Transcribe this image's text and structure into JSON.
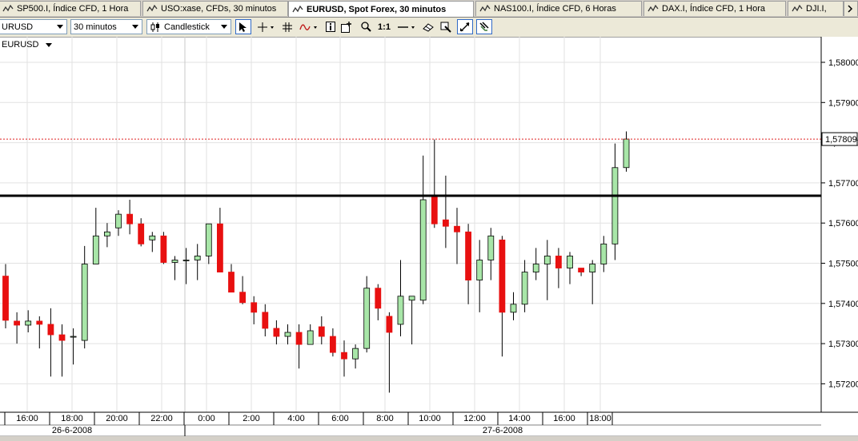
{
  "tabs": [
    {
      "label": "SP500.I, Índice CFD, 1 Hora",
      "active": false
    },
    {
      "label": "USO:xase, CFDs, 30 minutos",
      "active": false
    },
    {
      "label": "EURUSD, Spot Forex, 30 minutos",
      "active": true
    },
    {
      "label": "NAS100.I, Índice CFD, 6 Horas",
      "active": false
    },
    {
      "label": "DAX.I, Índice CFD, 1 Hora",
      "active": false
    },
    {
      "label": "DJI.I,",
      "active": false
    }
  ],
  "toolbar": {
    "symbol_value": "URUSD",
    "timeframe_value": "30 minutos",
    "charttype_value": "Candlestick",
    "ratio_label": "1:1"
  },
  "chart_title": "EURUSD",
  "colors": {
    "up": "#a8e6a8",
    "down": "#e81010",
    "horizontal_line": "#000000",
    "price_line": "#e02020"
  },
  "chart_data": {
    "type": "candlestick",
    "symbol": "EURUSD",
    "y_ticks": [
      "1,58000",
      "1,57900",
      "1,57800",
      "1,57700",
      "1,57600",
      "1,57500",
      "1,57400",
      "1,57300",
      "1,57200"
    ],
    "y_tick_values": [
      1.58,
      1.579,
      1.578,
      1.577,
      1.576,
      1.575,
      1.574,
      1.573,
      1.572
    ],
    "ylim": [
      1.5714,
      1.5814
    ],
    "current_price": "1,57809",
    "current_price_value": 1.57809,
    "horizontal_line_value": 1.57668,
    "x_ticks": [
      "16:00",
      "18:00",
      "20:00",
      "22:00",
      "0:00",
      "2:00",
      "4:00",
      "6:00",
      "8:00",
      "10:00",
      "12:00",
      "14:00",
      "16:00",
      "18:00"
    ],
    "dates": [
      "26-6-2008",
      "27-6-2008"
    ],
    "candles": [
      {
        "o": 1.57468,
        "h": 1.57498,
        "l": 1.57338,
        "c": 1.57358
      },
      {
        "o": 1.57356,
        "h": 1.57378,
        "l": 1.573,
        "c": 1.57346
      },
      {
        "o": 1.57346,
        "h": 1.57383,
        "l": 1.57328,
        "c": 1.57356
      },
      {
        "o": 1.57356,
        "h": 1.57368,
        "l": 1.57288,
        "c": 1.57348
      },
      {
        "o": 1.57348,
        "h": 1.57388,
        "l": 1.57218,
        "c": 1.57322
      },
      {
        "o": 1.57322,
        "h": 1.57348,
        "l": 1.57218,
        "c": 1.57308
      },
      {
        "o": 1.57318,
        "h": 1.57338,
        "l": 1.57248,
        "c": 1.57318
      },
      {
        "o": 1.57308,
        "h": 1.57543,
        "l": 1.57288,
        "c": 1.57498
      },
      {
        "o": 1.57498,
        "h": 1.57638,
        "l": 1.57498,
        "c": 1.57568
      },
      {
        "o": 1.57568,
        "h": 1.576,
        "l": 1.5754,
        "c": 1.57578
      },
      {
        "o": 1.57588,
        "h": 1.57632,
        "l": 1.57568,
        "c": 1.57622
      },
      {
        "o": 1.57622,
        "h": 1.57658,
        "l": 1.57572,
        "c": 1.57598
      },
      {
        "o": 1.57598,
        "h": 1.57612,
        "l": 1.57542,
        "c": 1.57548
      },
      {
        "o": 1.57558,
        "h": 1.57578,
        "l": 1.57528,
        "c": 1.57568
      },
      {
        "o": 1.57568,
        "h": 1.57578,
        "l": 1.57498,
        "c": 1.57502
      },
      {
        "o": 1.57502,
        "h": 1.57518,
        "l": 1.57458,
        "c": 1.57508
      },
      {
        "o": 1.57508,
        "h": 1.57538,
        "l": 1.57448,
        "c": 1.57508
      },
      {
        "o": 1.57508,
        "h": 1.57548,
        "l": 1.57458,
        "c": 1.57518
      },
      {
        "o": 1.57518,
        "h": 1.57598,
        "l": 1.57498,
        "c": 1.57598
      },
      {
        "o": 1.57598,
        "h": 1.57638,
        "l": 1.57478,
        "c": 1.57478
      },
      {
        "o": 1.57478,
        "h": 1.57498,
        "l": 1.57428,
        "c": 1.57428
      },
      {
        "o": 1.57428,
        "h": 1.57468,
        "l": 1.57398,
        "c": 1.57402
      },
      {
        "o": 1.57402,
        "h": 1.57418,
        "l": 1.57348,
        "c": 1.57378
      },
      {
        "o": 1.57378,
        "h": 1.57398,
        "l": 1.57318,
        "c": 1.57338
      },
      {
        "o": 1.57338,
        "h": 1.57358,
        "l": 1.57298,
        "c": 1.57318
      },
      {
        "o": 1.57318,
        "h": 1.57348,
        "l": 1.57298,
        "c": 1.57328
      },
      {
        "o": 1.57328,
        "h": 1.57348,
        "l": 1.57238,
        "c": 1.57298
      },
      {
        "o": 1.57298,
        "h": 1.57348,
        "l": 1.57298,
        "c": 1.57332
      },
      {
        "o": 1.57342,
        "h": 1.57368,
        "l": 1.57298,
        "c": 1.57318
      },
      {
        "o": 1.57318,
        "h": 1.57338,
        "l": 1.57268,
        "c": 1.57278
      },
      {
        "o": 1.57278,
        "h": 1.57308,
        "l": 1.57218,
        "c": 1.57262
      },
      {
        "o": 1.57262,
        "h": 1.57298,
        "l": 1.57238,
        "c": 1.57288
      },
      {
        "o": 1.57288,
        "h": 1.57468,
        "l": 1.57278,
        "c": 1.57438
      },
      {
        "o": 1.57438,
        "h": 1.57448,
        "l": 1.57358,
        "c": 1.57388
      },
      {
        "o": 1.57368,
        "h": 1.57378,
        "l": 1.57178,
        "c": 1.57328
      },
      {
        "o": 1.57348,
        "h": 1.57508,
        "l": 1.57318,
        "c": 1.57418
      },
      {
        "o": 1.57408,
        "h": 1.57418,
        "l": 1.57298,
        "c": 1.57418
      },
      {
        "o": 1.57408,
        "h": 1.57768,
        "l": 1.57398,
        "c": 1.57658
      },
      {
        "o": 1.57668,
        "h": 1.57808,
        "l": 1.57588,
        "c": 1.57598
      },
      {
        "o": 1.57608,
        "h": 1.57718,
        "l": 1.57538,
        "c": 1.57592
      },
      {
        "o": 1.57592,
        "h": 1.57638,
        "l": 1.57498,
        "c": 1.57578
      },
      {
        "o": 1.57578,
        "h": 1.57598,
        "l": 1.57398,
        "c": 1.57458
      },
      {
        "o": 1.57458,
        "h": 1.57558,
        "l": 1.57378,
        "c": 1.57508
      },
      {
        "o": 1.57508,
        "h": 1.57588,
        "l": 1.57458,
        "c": 1.57568
      },
      {
        "o": 1.57558,
        "h": 1.57568,
        "l": 1.57268,
        "c": 1.57378
      },
      {
        "o": 1.57378,
        "h": 1.57428,
        "l": 1.57358,
        "c": 1.57398
      },
      {
        "o": 1.57398,
        "h": 1.57508,
        "l": 1.57378,
        "c": 1.57478
      },
      {
        "o": 1.57478,
        "h": 1.57538,
        "l": 1.57458,
        "c": 1.57498
      },
      {
        "o": 1.57498,
        "h": 1.57558,
        "l": 1.57408,
        "c": 1.57518
      },
      {
        "o": 1.57518,
        "h": 1.57538,
        "l": 1.57438,
        "c": 1.57488
      },
      {
        "o": 1.57488,
        "h": 1.57528,
        "l": 1.57448,
        "c": 1.57518
      },
      {
        "o": 1.57488,
        "h": 1.57488,
        "l": 1.57468,
        "c": 1.57478
      },
      {
        "o": 1.57478,
        "h": 1.57508,
        "l": 1.57398,
        "c": 1.57498
      },
      {
        "o": 1.57498,
        "h": 1.57568,
        "l": 1.57478,
        "c": 1.57548
      },
      {
        "o": 1.57548,
        "h": 1.57798,
        "l": 1.57508,
        "c": 1.57738
      },
      {
        "o": 1.57738,
        "h": 1.57828,
        "l": 1.57728,
        "c": 1.57809
      }
    ]
  }
}
